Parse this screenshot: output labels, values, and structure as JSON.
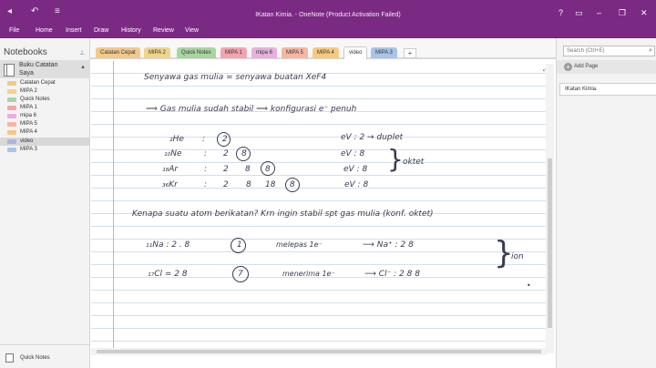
{
  "window": {
    "title": "IKatan Kimia. - OneNote (Product Activation Failed)",
    "controls": [
      "?",
      "▭",
      "–",
      "❐",
      "✕"
    ]
  },
  "quick_access": [
    "◂",
    "↶",
    "≡"
  ],
  "ribbon": {
    "tabs": [
      "File",
      "Home",
      "Insert",
      "Draw",
      "History",
      "Review",
      "View"
    ]
  },
  "left_pane": {
    "header": "Notebooks",
    "notebook": "Buku Catatan Saya",
    "sections": [
      {
        "label": "Catatan Cepat",
        "color": "#f2c98a"
      },
      {
        "label": "MIPA 2",
        "color": "#f0d48a"
      },
      {
        "label": "Quick Notes",
        "color": "#a9d5a0"
      },
      {
        "label": "MIPA 1",
        "color": "#f3a3b0"
      },
      {
        "label": "mipa 6",
        "color": "#e7b0df"
      },
      {
        "label": "MIPA 5",
        "color": "#f6b6a0"
      },
      {
        "label": "MIPA 4",
        "color": "#f7c97e"
      },
      {
        "label": "video",
        "color": "#b3b0e6"
      },
      {
        "label": "MIPA 3",
        "color": "#a9c4ea"
      }
    ],
    "quick_notes": "Quick Notes"
  },
  "section_tabs": {
    "tabs": [
      {
        "label": "Catatan Cepat",
        "color": "#f2c98a"
      },
      {
        "label": "MIPA 2",
        "color": "#f0d48a"
      },
      {
        "label": "Quick Notes",
        "color": "#a9d5a0"
      },
      {
        "label": "MIPA 1",
        "color": "#f3a3b0"
      },
      {
        "label": "mipa 6",
        "color": "#e7b0df"
      },
      {
        "label": "MIPA 5",
        "color": "#f6b6a0"
      },
      {
        "label": "MIPA 4",
        "color": "#f7c97e"
      },
      {
        "label": "video",
        "color": "#ffffff"
      },
      {
        "label": "MIPA 3",
        "color": "#a9c4ea"
      }
    ],
    "add": "+"
  },
  "right_pane": {
    "search_placeholder": "Search (Ctrl+E)",
    "add_page": "Add Page",
    "pages": [
      "IKatan Kimia."
    ]
  },
  "note": {
    "l1": "Senyawa gas mulia = senyawa buatan   XeF4",
    "l2": "⟹  Gas mulia sudah stabil ⟹ konfigurasi e⁻ penuh",
    "he": "₂He",
    "he_eq": ":",
    "he_v": "2",
    "ne": "₁₀Ne",
    "ne_eq": ":",
    "ne_v1": "2",
    "ne_v2": "8",
    "ar": "₁₈Ar",
    "ar_eq": ":",
    "ar_v1": "2",
    "ar_v2": "8",
    "ar_v3": "8",
    "kr": "₃₆Kr",
    "kr_eq": ":",
    "kr_v1": "2",
    "kr_v2": "8",
    "kr_v3": "18",
    "kr_v4": "8",
    "ev1": "eV : 2  →  duplet",
    "ev2": "eV : 8",
    "ev3": "eV : 8",
    "ev4": "eV : 8",
    "oktet": "oktet",
    "q": "Kenapa suatu atom berikatan?  Krn ingin stabil spt gas mulia (konf. oktet)",
    "na": "₁₁Na  :  2 . 8",
    "na_v": "1",
    "na_act": "melepas 1e⁻",
    "na_ion": "⟶  Na⁺  :  2    8",
    "cl": "₁₇Cl   =  2   8",
    "cl_v": "7",
    "cl_act": "menerima 1e⁻",
    "cl_ion": "⟶  Cl⁻  :  2   8   8",
    "ion": "ion"
  }
}
